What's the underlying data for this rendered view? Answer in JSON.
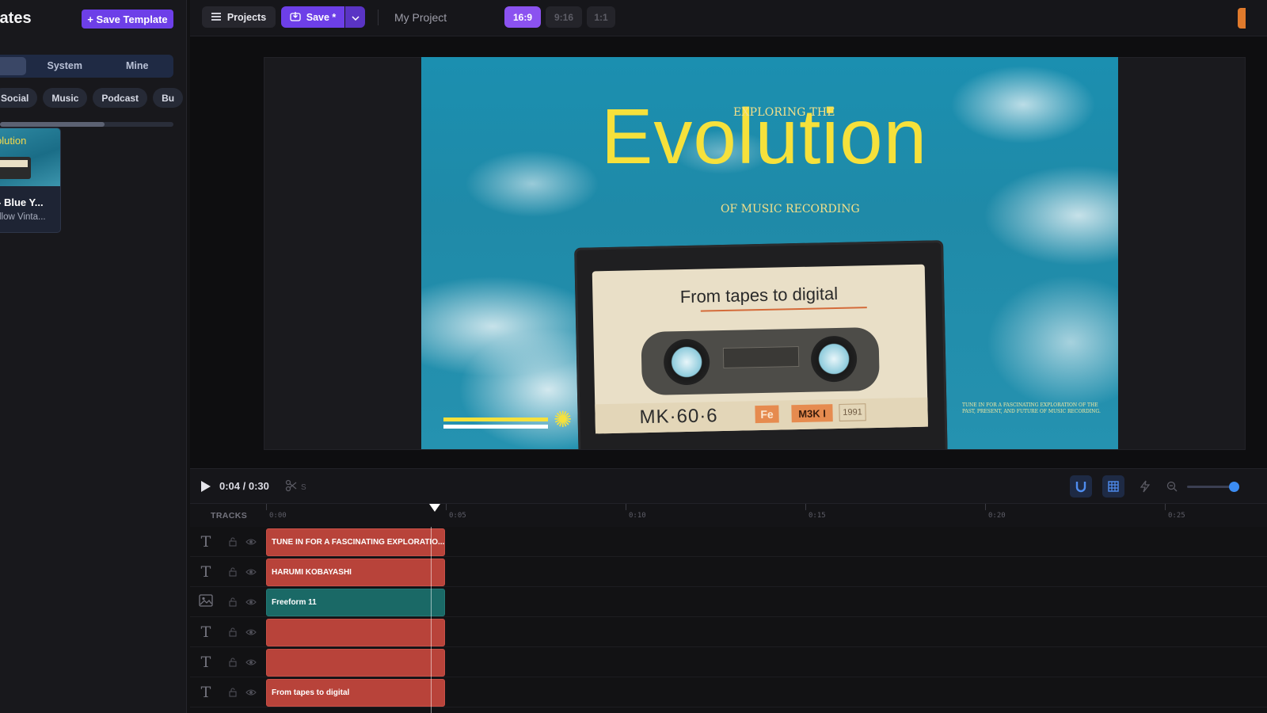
{
  "sidebar": {
    "title": "lates",
    "save_template_label": "+ Save Template",
    "segments": [
      "",
      "System",
      "Mine"
    ],
    "categories": [
      "Social",
      "Music",
      "Podcast",
      "Bu"
    ],
    "template_card": {
      "thumb_title": "olution",
      "name": "- Blue Y...",
      "subtitle": "llow Vinta..."
    }
  },
  "topbar": {
    "projects_label": "Projects",
    "save_label": "Save *",
    "project_name": "My Project",
    "ratios": [
      "16:9",
      "9:16",
      "1:1"
    ],
    "active_ratio": "16:9",
    "accent": "#6d3fe8"
  },
  "canvas": {
    "subhead": "EXPLORING THE",
    "title": "Evolution",
    "tagline": "OF MUSIC RECORDING",
    "cassette_label": "From tapes to digital",
    "cassette_model": "MK·60·6",
    "cassette_tag1": "Fe",
    "cassette_tag2": "M3K I",
    "cassette_year": "1991",
    "fine_print": "TUNE IN FOR A FASCINATING EXPLORATION OF THE PAST, PRESENT, AND FUTURE OF MUSIC RECORDING.",
    "title_color": "#f6e13b",
    "sky_color": "#1f8aa8"
  },
  "timeline": {
    "timecode": "0:04 / 0:30",
    "split_shortcut": "S",
    "tracks_label": "TRACKS",
    "ruler_ticks": [
      "0:00",
      "0:05",
      "0:10",
      "0:15",
      "0:20",
      "0:25"
    ],
    "tracks": [
      {
        "type": "text",
        "clip": "TUNE IN FOR A FASCINATING EXPLORATIO..."
      },
      {
        "type": "text",
        "clip": "HARUMI KOBAYASHI"
      },
      {
        "type": "image",
        "clip": "Freeform 11"
      },
      {
        "type": "text",
        "clip": ""
      },
      {
        "type": "text",
        "clip": ""
      },
      {
        "type": "text",
        "clip": "From tapes to digital"
      }
    ]
  }
}
